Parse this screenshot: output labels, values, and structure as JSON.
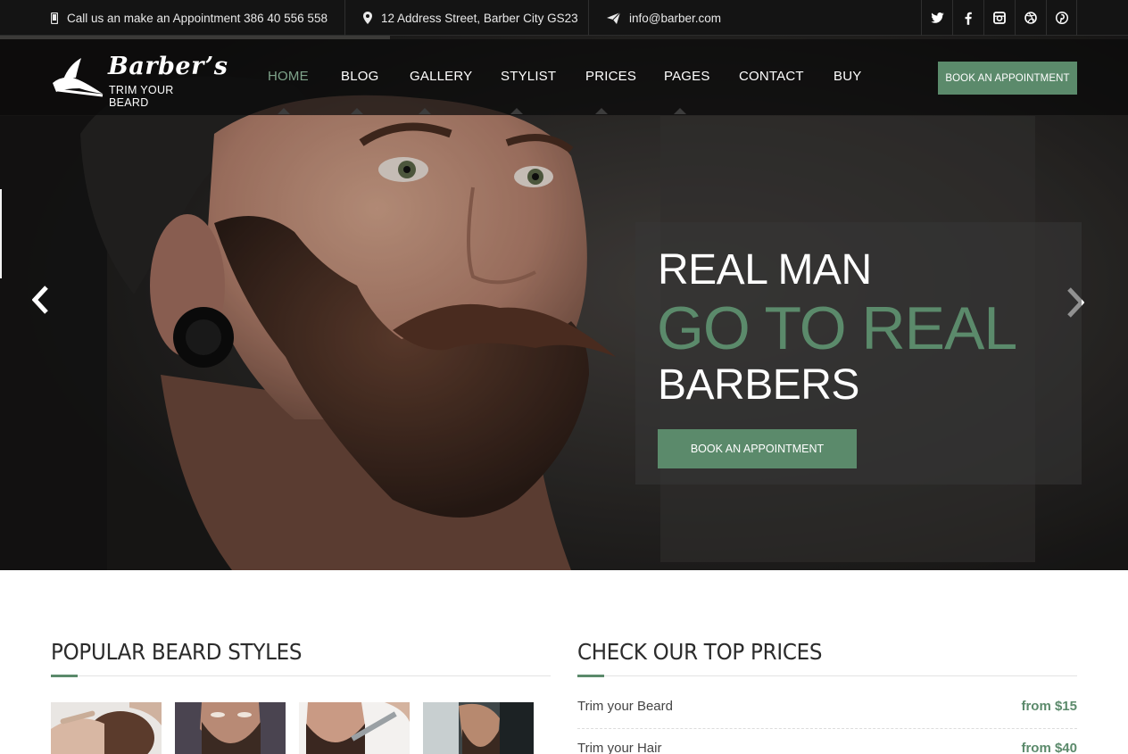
{
  "topbar": {
    "phone": "Call us an make an Appointment 386 40 556 558",
    "address": "12 Address Street, Barber City GS23",
    "email": "info@barber.com",
    "social": [
      "twitter-icon",
      "facebook-icon",
      "instagram-icon",
      "dribbble-icon",
      "pinterest-icon"
    ]
  },
  "brand": {
    "title": "Barber’s",
    "subtitle": "TRIM YOUR BEARD"
  },
  "nav": {
    "items": [
      "HOME",
      "BLOG",
      "GALLERY",
      "STYLIST",
      "PRICES",
      "PAGES",
      "CONTACT",
      "BUY"
    ],
    "active": "HOME",
    "cta": "BOOK AN APPOINTMENT"
  },
  "slide": {
    "line1": "REAL MAN",
    "line2": "GO TO REAL",
    "line3": "BARBERS",
    "button": "BOOK AN APPOINTMENT"
  },
  "beard_styles": {
    "title": "POPULAR BEARD STYLES"
  },
  "prices": {
    "title": "CHECK OUR TOP PRICES",
    "items": [
      {
        "name": "Trim your Beard",
        "price": "from $15"
      },
      {
        "name": "Trim your Hair",
        "price": "from $40"
      }
    ]
  },
  "colors": {
    "accent": "#5b8a6b",
    "topbar": "#141414",
    "heading": "#2b2b2b"
  }
}
